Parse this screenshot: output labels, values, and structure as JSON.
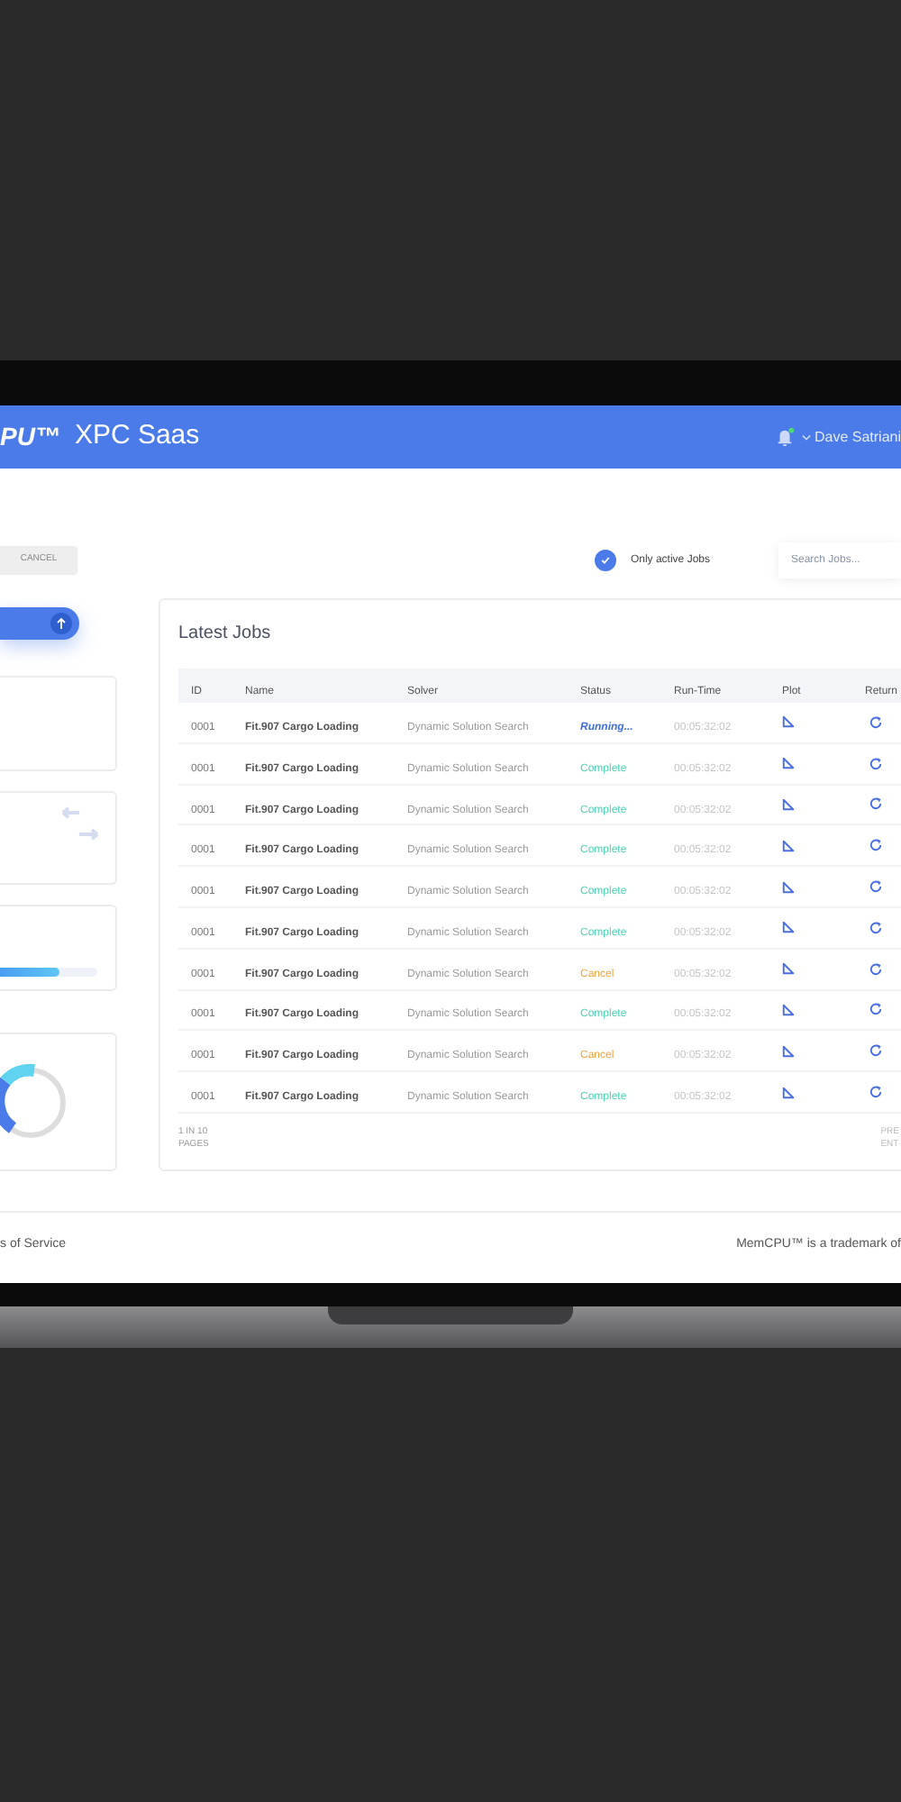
{
  "header": {
    "logo": "PU™",
    "title": "XPC Saas",
    "user": "Dave Satriani"
  },
  "toolbar": {
    "cancel": "CANCEL",
    "only_active": {
      "label": "Only active Jobs",
      "checked": true
    },
    "search": {
      "placeholder": "Search Jobs..."
    }
  },
  "side": {
    "progress": {
      "level": 0.62
    }
  },
  "jobs": {
    "title": "Latest Jobs",
    "columns": [
      "ID",
      "Name",
      "Solver",
      "Status",
      "Run-Time",
      "Plot",
      "Return"
    ],
    "rows": [
      {
        "id": "0001",
        "name": "Fit.907 Cargo Loading",
        "solver": "Dynamic Solution Search",
        "status": "Running...",
        "kind": "running",
        "run_time": "00:05:32:02"
      },
      {
        "id": "0001",
        "name": "Fit.907 Cargo Loading",
        "solver": "Dynamic Solution Search",
        "status": "Complete",
        "kind": "complete",
        "run_time": "00:05:32:02"
      },
      {
        "id": "0001",
        "name": "Fit.907 Cargo Loading",
        "solver": "Dynamic Solution Search",
        "status": "Complete",
        "kind": "complete",
        "run_time": "00:05:32:02"
      },
      {
        "id": "0001",
        "name": "Fit.907 Cargo Loading",
        "solver": "Dynamic Solution Search",
        "status": "Complete",
        "kind": "complete",
        "run_time": "00:05:32:02"
      },
      {
        "id": "0001",
        "name": "Fit.907 Cargo Loading",
        "solver": "Dynamic Solution Search",
        "status": "Complete",
        "kind": "complete",
        "run_time": "00:05:32:02"
      },
      {
        "id": "0001",
        "name": "Fit.907 Cargo Loading",
        "solver": "Dynamic Solution Search",
        "status": "Complete",
        "kind": "complete",
        "run_time": "00:05:32:02"
      },
      {
        "id": "0001",
        "name": "Fit.907 Cargo Loading",
        "solver": "Dynamic Solution Search",
        "status": "Cancel",
        "kind": "cancel",
        "run_time": "00:05:32:02"
      },
      {
        "id": "0001",
        "name": "Fit.907 Cargo Loading",
        "solver": "Dynamic Solution Search",
        "status": "Complete",
        "kind": "complete",
        "run_time": "00:05:32:02"
      },
      {
        "id": "0001",
        "name": "Fit.907 Cargo Loading",
        "solver": "Dynamic Solution Search",
        "status": "Cancel",
        "kind": "cancel",
        "run_time": "00:05:32:02"
      },
      {
        "id": "0001",
        "name": "Fit.907 Cargo Loading",
        "solver": "Dynamic Solution Search",
        "status": "Complete",
        "kind": "complete",
        "run_time": "00:05:32:02"
      }
    ],
    "pagination": "1 IN 10 PAGES",
    "pager": [
      "PRE",
      "ENT"
    ]
  },
  "footer": {
    "left": "s of Service",
    "right": "MemCPU™ is a trademark of"
  }
}
